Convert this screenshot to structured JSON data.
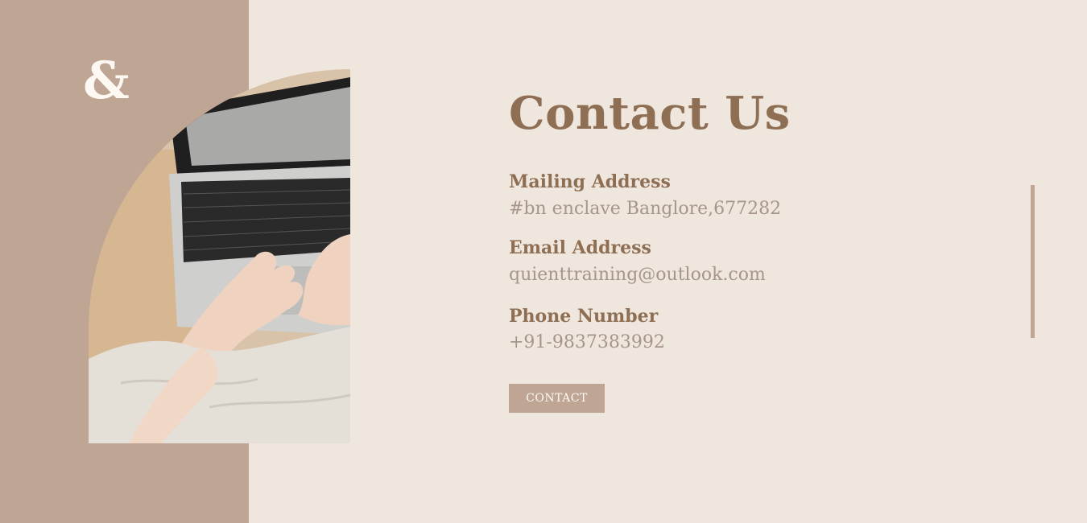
{
  "logo": {
    "text": "&"
  },
  "title": "Contact Us",
  "mailing": {
    "label": "Mailing Address",
    "value": "#bn enclave Banglore,677282"
  },
  "email": {
    "label": "Email Address",
    "value": "quienttraining@outlook.com"
  },
  "phone": {
    "label": "Phone Number",
    "value": "+91-9837383992"
  },
  "button": {
    "label": "CONTACT"
  },
  "colors": {
    "panel": "#bfa593",
    "background": "#efe6dd",
    "heading": "#8f6f54",
    "text": "#a6968a"
  }
}
